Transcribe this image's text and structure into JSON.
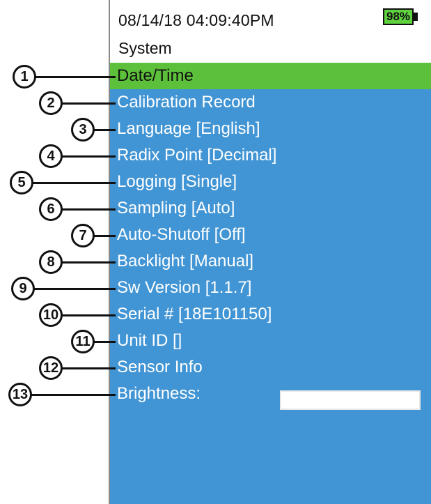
{
  "status": {
    "datetime": "08/14/18  04:09:40PM",
    "battery": "98%"
  },
  "screen": {
    "title": "System"
  },
  "menu": {
    "items": [
      {
        "callout": "1",
        "label": "Date/Time"
      },
      {
        "callout": "2",
        "label": "Calibration Record"
      },
      {
        "callout": "3",
        "label": "Language [English]"
      },
      {
        "callout": "4",
        "label": "Radix Point [Decimal]"
      },
      {
        "callout": "5",
        "label": "Logging [Single]"
      },
      {
        "callout": "6",
        "label": "Sampling [Auto]"
      },
      {
        "callout": "7",
        "label": "Auto-Shutoff [Off]"
      },
      {
        "callout": "8",
        "label": "Backlight [Manual]"
      },
      {
        "callout": "9",
        "label": "Sw Version [1.1.7]"
      },
      {
        "callout": "10",
        "label": "Serial # [18E101150]"
      },
      {
        "callout": "11",
        "label": "Unit ID []"
      },
      {
        "callout": "12",
        "label": "Sensor Info"
      },
      {
        "callout": "13",
        "label": "Brightness:"
      }
    ]
  },
  "colors": {
    "menu_background": "#4295d4",
    "selected_background": "#5cc03a",
    "battery_fill": "#5fd33f"
  }
}
